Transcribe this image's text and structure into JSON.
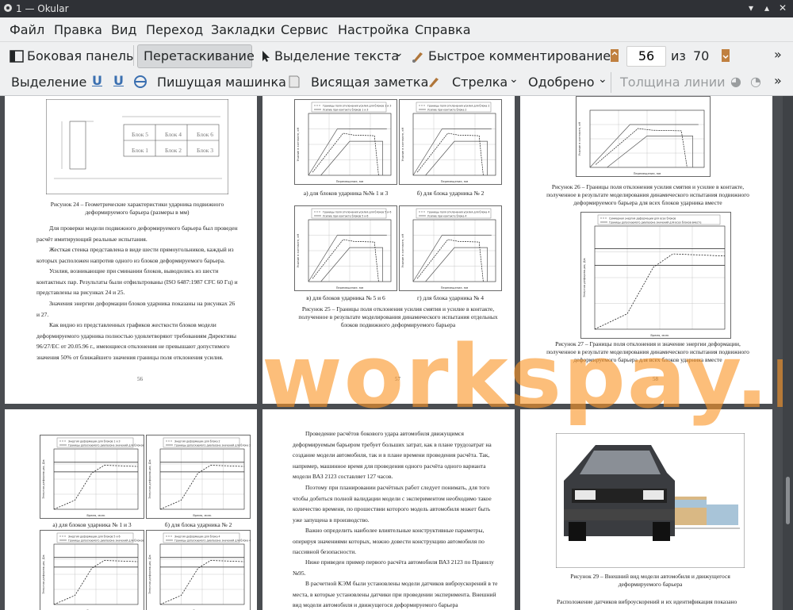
{
  "window": {
    "title": "1 — Okular"
  },
  "menu": [
    "Файл",
    "Правка",
    "Вид",
    "Переход",
    "Закладки",
    "Сервис",
    "Настройка",
    "Справка"
  ],
  "toolbar1": {
    "sidebar": "Боковая панель",
    "drag": "Перетаскивание",
    "text_select": "Выделение текста",
    "quick_comment": "Быстрое комментирование",
    "page_current": "56",
    "page_of": "из",
    "page_total": "70"
  },
  "toolbar2": {
    "highlight": "Выделение",
    "typewriter": "Пишущая машинка",
    "note": "Висящая заметка",
    "arrow": "Стрелка",
    "stamp": "Одобрено",
    "line_width": "Толщина линии"
  },
  "pages": {
    "p56": {
      "figure_caption": "Рисунок 24 – Геометрические характеристики ударника подвижного деформируемого барьера (размеры в мм)",
      "blocks": [
        "Блок 5",
        "Блок 4",
        "Блок 6",
        "Блок 1",
        "Блок 2",
        "Блок 3"
      ],
      "paragraphs": [
        "Для проверки модели подвижного деформируемого барьера был проведен расчёт имитирующий реальные испытания.",
        "Жесткая стенка представлена в виде шести прямоугольников, каждый из которых расположен напротив одного из блоков деформируемого барьера.",
        "Усилия, возникающие при сминании блоков, выводились из шести контактных пар. Результаты были отфильтрованы (ISO 6487:1987 CFC 60 Гц) и представлены на рисунках 24 и 25.",
        "Значения энергии деформации блоков ударника показаны на рисунках 26 и 27.",
        "Как видно из представленных графиков жесткости блоков модели деформируемого ударника полностью удовлетворяют требованиям Директивы 96/27/ЕС от 20.05.96 г., имеющиеся отклонения не превышают допустимого значения 50% от ближайшего значения границы поля отклонения усилия."
      ],
      "page_number": "56"
    },
    "p57": {
      "sub_a": "а) для блоков ударника №№ 1 и 3",
      "sub_b": "б) для блока ударника № 2",
      "sub_c": "в) для блоков ударника № 5 и 6",
      "sub_d": "г) для блока ударника № 4",
      "legend_a": [
        "Границы поля отклонения усилия для блоков 1 и 3",
        "Усилие при контакте блоков 1 и 3"
      ],
      "legend_b": [
        "Границы поля отклонения усилия для блока 2",
        "Усилие при контакте блока 2"
      ],
      "legend_c": [
        "Границы поля отклонения усилия для блоков 5 и 6",
        "Усилие при контакте блоков 5 и 6"
      ],
      "legend_d": [
        "Границы поля отклонения усилия для блока 4",
        "Усилие при контакте блока 4"
      ],
      "xlabel": "Перемещение, мм",
      "ylabel": "Усилие в контакте, кН",
      "figure_caption": "Рисунок 25 – Границы поля отклонения усилия смятия и усилие в контакте, полученное в результате моделирования динамического испытания отдельных блоков подвижного деформируемого барьера",
      "page_number": "57"
    },
    "p58": {
      "ylabel_top": "Усилие в контакте, кН",
      "xlabel_top": "Перемещение, мм",
      "fig26": "Рисунок 26 – Границы поля отклонения усилия смятия и усилие в контакте, полученное в результате моделирования динамического испытания подвижного деформируемого барьера для всех блоков ударника вместе",
      "legend27": [
        "Суммарная энергия деформации для всех блоков",
        "Границы допускаемого диапазона значений для всех блоков вместе"
      ],
      "xlabel27": "Время, мсек",
      "ylabel27": "Энергия деформации, Дж",
      "fig27": "Рисунок 27 – Границы поля отклонения и значение энергии деформации, полученное в результате моделирования динамического испытания подвижного деформируемого барьера для всех блоков ударника вместе",
      "page_number": "58"
    },
    "p59": {
      "sub_a": "а) для блоков ударника № 1 и 3",
      "sub_b": "б) для блока ударника № 2",
      "legend_a": [
        "Энергия деформации для блоков 1 и 3",
        "Границы допускаемого диапазона значений для блоков 1 и 3"
      ],
      "legend_b": [
        "Энергия деформации для блока 2",
        "Границы допускаемого диапазона значений для блока 2"
      ],
      "legend_c": [
        "Энергия деформации для блоков 5 и 6",
        "Границы допускаемого диапазона значений для блоков 5 и 6"
      ],
      "legend_d": [
        "Энергия деформации для блока 4",
        "Границы допускаемого диапазона значений для блока 4"
      ],
      "xlabel": "Время, мсек",
      "ylabel": "Энергия деформации, Дж"
    },
    "p60": {
      "paragraphs": [
        "Проведение расчётов бокового удара автомобиля движущимся деформируемым барьером требует больших затрат, как в плане трудозатрат на создание модели автомобиля, так и в плане времени проведения расчёта. Так, например, машинное время для проведения одного расчёта одного варианта модели ВАЗ 2123 составляет 127 часов.",
        "Поэтому при планировании расчётных работ следует понимать, для того чтобы добиться полной валидации модели с экспериментом необходимо такое количество времени, по прошествии которого модель автомобиля может быть уже запущена в производство.",
        "Важно определить наиболее влиятельные конструктивные параметры, оперируя значениями которых, можно довести конструкцию автомобиля по пассивной безопасности.",
        "Ниже приведен пример первого расчёта автомобиля ВАЗ 2123 по Правилу №95.",
        "В расчетной КЭМ были установлены модели датчиков виброускорений в те места, в которые установлены датчики при проведении эксперимента. Внешний вид модели автомобиля и движущегося деформируемого барьера"
      ]
    },
    "p61": {
      "figure_caption": "Рисунок 29 – Внешний вид модели автомобиля и движущегося деформируемого барьера",
      "tail": "Расположение датчиков виброускорений и их идентификация показано"
    }
  },
  "watermark": "workspay.ru",
  "colors": {
    "menubar": "#eff0f1",
    "titlebar": "#2f3136",
    "viewport": "#4a4d51",
    "watermark": "#fa9628"
  }
}
